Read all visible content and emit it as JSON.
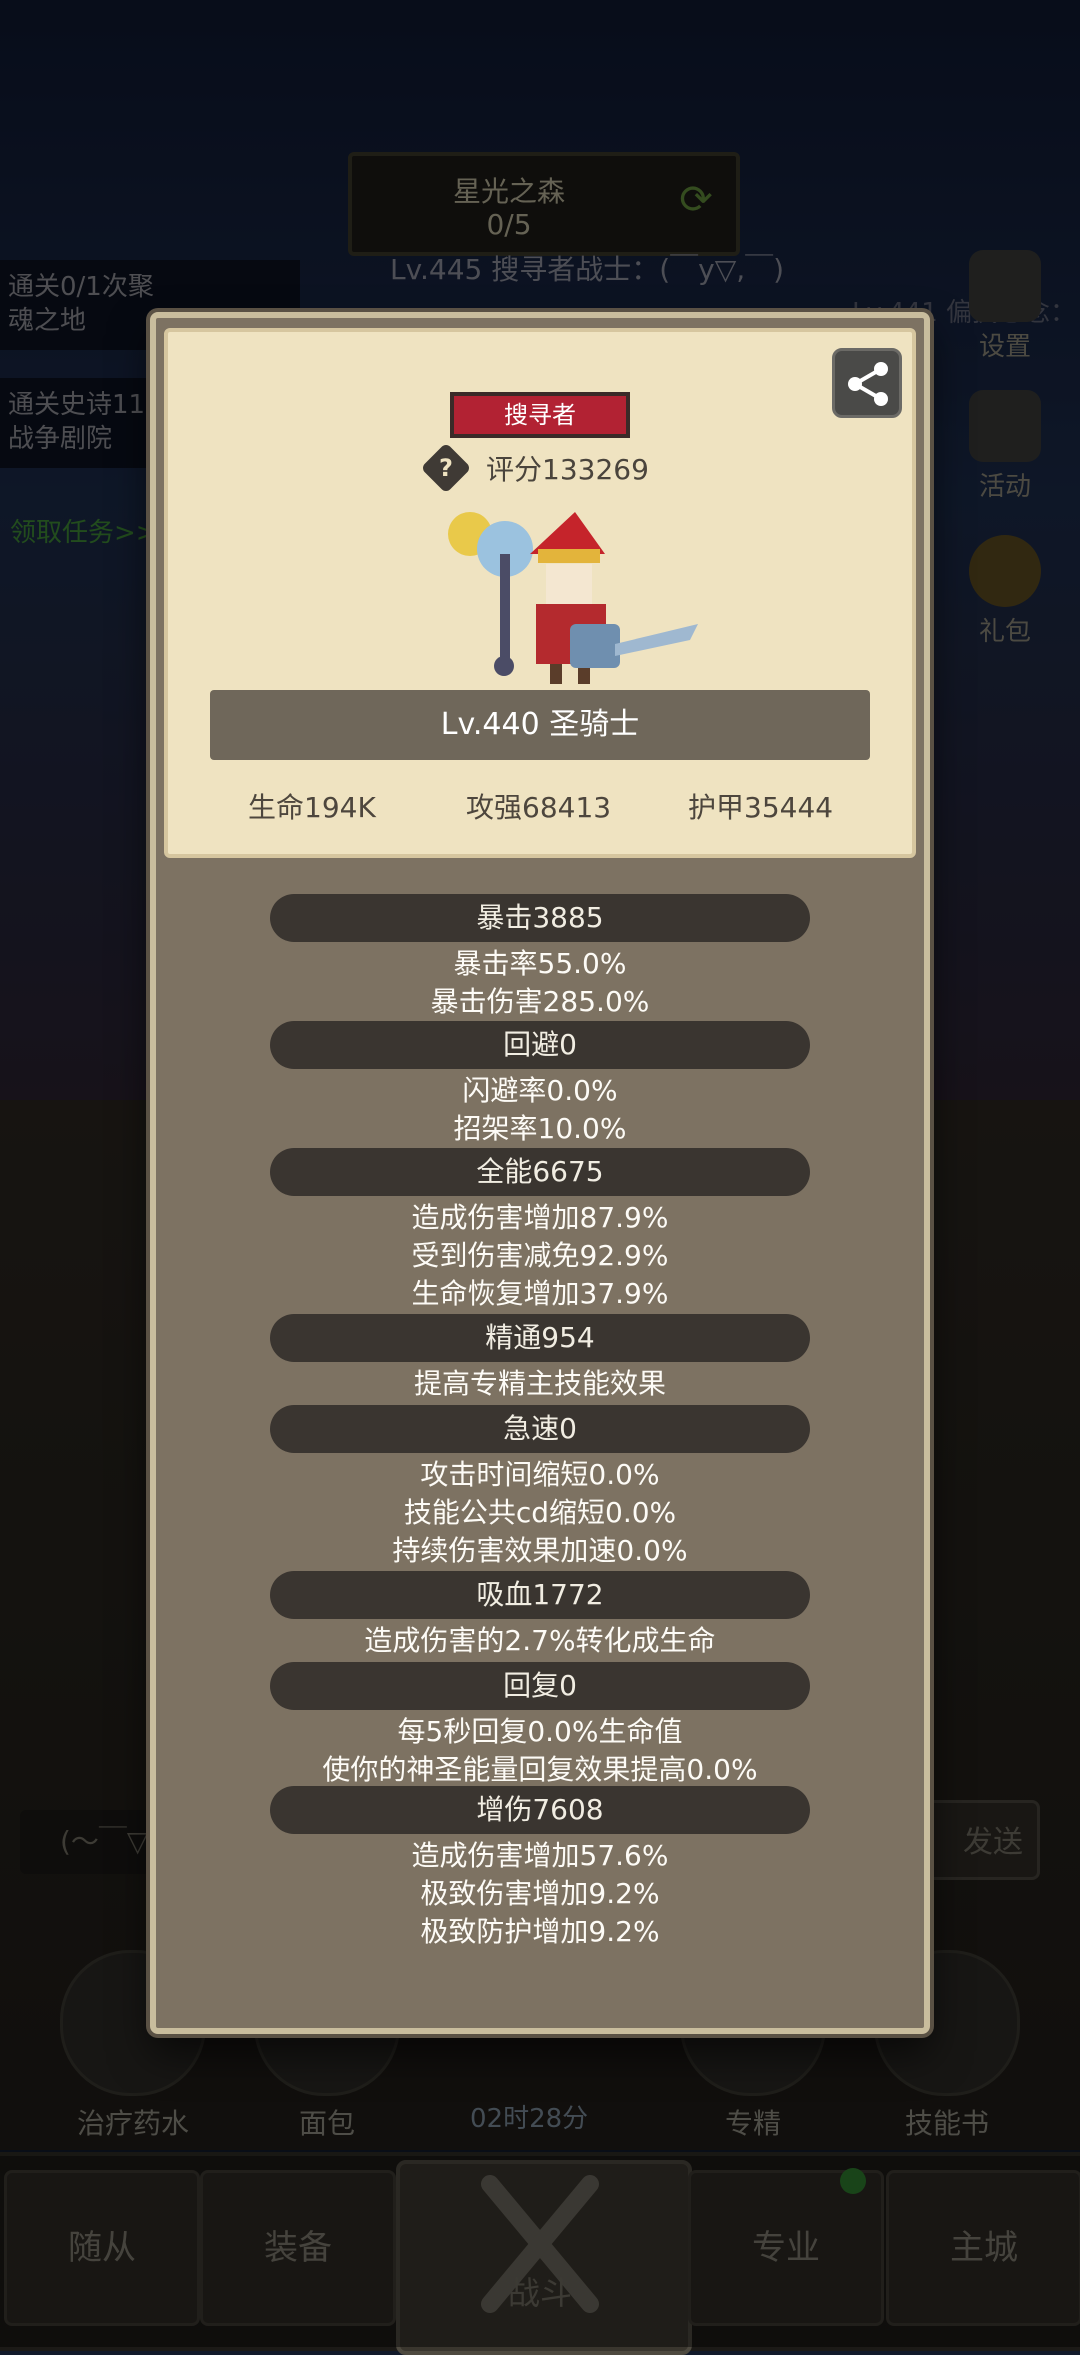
{
  "zone": {
    "name": "星光之森",
    "progress": "0/5"
  },
  "player_line": "Lv.445 搜寻者战士：(￣y▽,￣)",
  "other_player_line": "Lv.441 偏执想念：",
  "quests": [
    {
      "line1": "通关0/1次聚",
      "line2": "魂之地"
    },
    {
      "line1": "通关史诗11",
      "line2": "战争剧院"
    }
  ],
  "quest_link": "领取任务>>",
  "side_buttons": [
    "设置",
    "活动",
    "礼包"
  ],
  "bottom_skills": [
    "治疗药水",
    "面包",
    "专精",
    "技能书"
  ],
  "timer": "02时28分",
  "nav_tabs": [
    "随从",
    "装备",
    "战斗",
    "专业",
    "主城"
  ],
  "chat_input_placeholder": "(～￣▽",
  "send_label": "发送",
  "modal": {
    "class_tag": "搜寻者",
    "score": "评分133269",
    "hero_name": "Lv.440 圣骑士",
    "stats_top": {
      "hp": "生命194K",
      "attack": "攻强68413",
      "armor": "护甲35444"
    },
    "sections": [
      {
        "title": "暴击3885",
        "lines": [
          "暴击率55.0%",
          "暴击伤害285.0%"
        ]
      },
      {
        "title": "回避0",
        "lines": [
          "闪避率0.0%",
          "招架率10.0%"
        ]
      },
      {
        "title": "全能6675",
        "lines": [
          "造成伤害增加87.9%",
          "受到伤害减免92.9%",
          "生命恢复增加37.9%"
        ]
      },
      {
        "title": "精通954",
        "lines": [
          "提高专精主技能效果"
        ]
      },
      {
        "title": "急速0",
        "lines": [
          "攻击时间缩短0.0%",
          "技能公共cd缩短0.0%",
          "持续伤害效果加速0.0%"
        ]
      },
      {
        "title": "吸血1772",
        "lines": [
          "造成伤害的2.7%转化成生命"
        ]
      },
      {
        "title": "回复0",
        "lines": [
          "每5秒回复0.0%生命值",
          "使你的神圣能量回复效果提高0.0%"
        ]
      },
      {
        "title": "增伤7608",
        "lines": [
          "造成伤害增加57.6%",
          "极致伤害增加9.2%",
          "极致防护增加9.2%"
        ]
      }
    ]
  },
  "colors": {
    "class_tag": "#b22233",
    "modal_bg": "#7d7262",
    "card_bg": "#efe3c1",
    "section_bar": "#3a3530"
  }
}
